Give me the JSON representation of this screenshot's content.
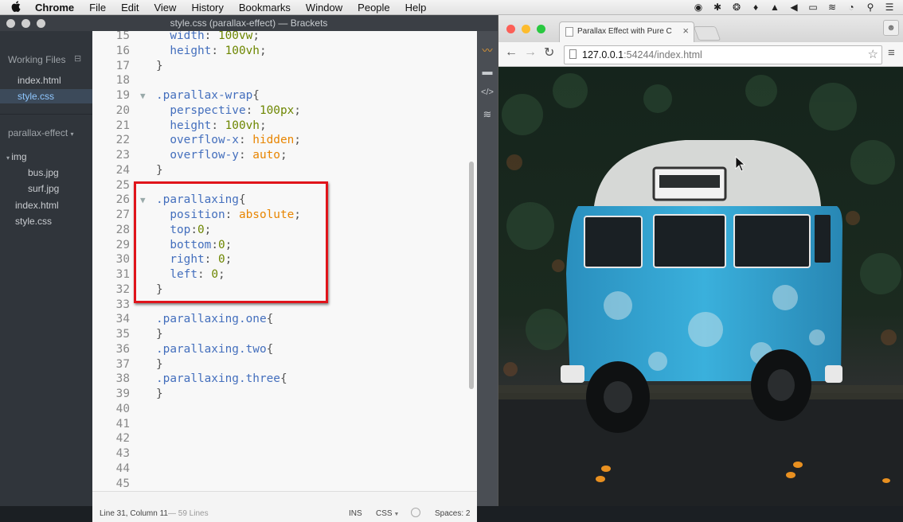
{
  "menubar": {
    "apple": "",
    "items": [
      "Chrome",
      "File",
      "Edit",
      "View",
      "History",
      "Bookmarks",
      "Window",
      "People",
      "Help"
    ],
    "status_icons": [
      "record-icon",
      "bluetooth-icon",
      "sync-icon",
      "notification-icon",
      "drive-icon",
      "volume-icon",
      "battery-icon",
      "wifi-icon",
      "clock-icon",
      "spotlight-icon",
      "list-icon"
    ]
  },
  "brackets": {
    "title": "style.css (parallax-effect) — Brackets",
    "sidebar": {
      "working_files_label": "Working Files",
      "working_files": [
        "index.html",
        "style.css"
      ],
      "project_label": "parallax-effect",
      "folder": "img",
      "folder_files": [
        "bus.jpg",
        "surf.jpg"
      ],
      "root_files": [
        "index.html",
        "style.css"
      ]
    },
    "status": {
      "cursor": "Line 31, Column 11",
      "lines": "— 59 Lines",
      "mode": "INS",
      "language": "CSS",
      "spaces": "Spaces: 2"
    }
  },
  "code_lines": [
    {
      "n": "15",
      "fold": "",
      "t": [
        [
          "  width",
          "prop"
        ],
        [
          ": ",
          "pun"
        ],
        [
          "100vw",
          "num"
        ],
        [
          ";",
          "pun"
        ]
      ]
    },
    {
      "n": "16",
      "fold": "",
      "t": [
        [
          "  height",
          "prop"
        ],
        [
          ": ",
          "pun"
        ],
        [
          "100vh",
          "num"
        ],
        [
          ";",
          "pun"
        ]
      ]
    },
    {
      "n": "17",
      "fold": "",
      "t": [
        [
          "}",
          "pun"
        ]
      ]
    },
    {
      "n": "18",
      "fold": "",
      "t": []
    },
    {
      "n": "19",
      "fold": "▼",
      "t": [
        [
          ".parallax-wrap",
          "sel"
        ],
        [
          "{",
          "pun"
        ]
      ]
    },
    {
      "n": "20",
      "fold": "",
      "t": [
        [
          "  perspective",
          "prop"
        ],
        [
          ": ",
          "pun"
        ],
        [
          "100px",
          "num"
        ],
        [
          ";",
          "pun"
        ]
      ]
    },
    {
      "n": "21",
      "fold": "",
      "t": [
        [
          "  height",
          "prop"
        ],
        [
          ": ",
          "pun"
        ],
        [
          "100vh",
          "num"
        ],
        [
          ";",
          "pun"
        ]
      ]
    },
    {
      "n": "22",
      "fold": "",
      "t": [
        [
          "  overflow-x",
          "prop"
        ],
        [
          ": ",
          "pun"
        ],
        [
          "hidden",
          "val"
        ],
        [
          ";",
          "pun"
        ]
      ]
    },
    {
      "n": "23",
      "fold": "",
      "t": [
        [
          "  overflow-y",
          "prop"
        ],
        [
          ": ",
          "pun"
        ],
        [
          "auto",
          "val"
        ],
        [
          ";",
          "pun"
        ]
      ]
    },
    {
      "n": "24",
      "fold": "",
      "t": [
        [
          "}",
          "pun"
        ]
      ]
    },
    {
      "n": "25",
      "fold": "",
      "t": []
    },
    {
      "n": "26",
      "fold": "▼",
      "t": [
        [
          ".parallaxing",
          "sel"
        ],
        [
          "{",
          "pun"
        ]
      ]
    },
    {
      "n": "27",
      "fold": "",
      "t": [
        [
          "  position",
          "prop"
        ],
        [
          ": ",
          "pun"
        ],
        [
          "absolute",
          "val"
        ],
        [
          ";",
          "pun"
        ]
      ]
    },
    {
      "n": "28",
      "fold": "",
      "t": [
        [
          "  top",
          "prop"
        ],
        [
          ":",
          "pun"
        ],
        [
          "0",
          "num"
        ],
        [
          ";",
          "pun"
        ]
      ]
    },
    {
      "n": "29",
      "fold": "",
      "t": [
        [
          "  bottom",
          "prop"
        ],
        [
          ":",
          "pun"
        ],
        [
          "0",
          "num"
        ],
        [
          ";",
          "pun"
        ]
      ]
    },
    {
      "n": "30",
      "fold": "",
      "t": [
        [
          "  right",
          "prop"
        ],
        [
          ": ",
          "pun"
        ],
        [
          "0",
          "num"
        ],
        [
          ";",
          "pun"
        ]
      ]
    },
    {
      "n": "31",
      "fold": "",
      "t": [
        [
          "  left",
          "prop"
        ],
        [
          ": ",
          "pun"
        ],
        [
          "0",
          "num"
        ],
        [
          ";",
          "pun"
        ]
      ]
    },
    {
      "n": "32",
      "fold": "",
      "t": [
        [
          "}",
          "pun"
        ]
      ]
    },
    {
      "n": "33",
      "fold": "",
      "t": []
    },
    {
      "n": "34",
      "fold": "",
      "t": [
        [
          ".parallaxing.one",
          "sel"
        ],
        [
          "{",
          "pun"
        ]
      ]
    },
    {
      "n": "35",
      "fold": "",
      "t": [
        [
          "}",
          "pun"
        ]
      ]
    },
    {
      "n": "36",
      "fold": "",
      "t": [
        [
          ".parallaxing.two",
          "sel"
        ],
        [
          "{",
          "pun"
        ]
      ]
    },
    {
      "n": "37",
      "fold": "",
      "t": [
        [
          "}",
          "pun"
        ]
      ]
    },
    {
      "n": "38",
      "fold": "",
      "t": [
        [
          ".parallaxing.three",
          "sel"
        ],
        [
          "{",
          "pun"
        ]
      ]
    },
    {
      "n": "39",
      "fold": "",
      "t": [
        [
          "}",
          "pun"
        ]
      ]
    },
    {
      "n": "40",
      "fold": "",
      "t": []
    },
    {
      "n": "41",
      "fold": "",
      "t": []
    },
    {
      "n": "42",
      "fold": "",
      "t": []
    },
    {
      "n": "43",
      "fold": "",
      "t": []
    },
    {
      "n": "44",
      "fold": "",
      "t": []
    },
    {
      "n": "45",
      "fold": "",
      "t": []
    }
  ],
  "chrome": {
    "tab_title": "Parallax Effect with Pure C",
    "tab_close": "×",
    "url_host": "127.0.0.1",
    "url_rest": ":54244/index.html",
    "page_image": "van-photo"
  },
  "colors": {
    "highlight_box": "#e0141b",
    "selector": "#446fbd",
    "value": "#e88501",
    "number": "#6d8600"
  }
}
